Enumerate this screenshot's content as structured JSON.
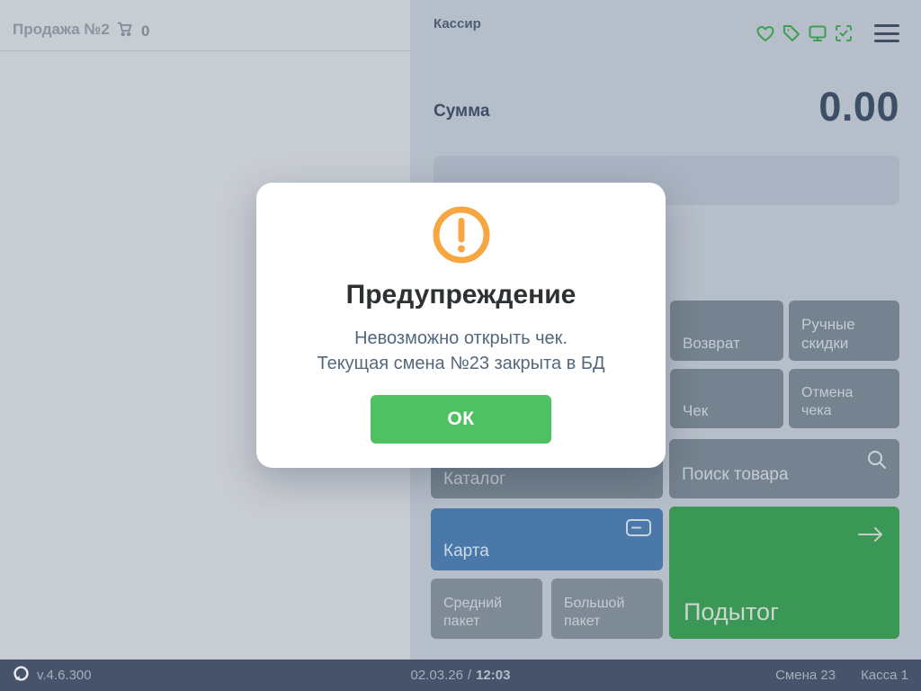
{
  "header": {
    "sale_title": "Продажа №2",
    "cart_count": "0",
    "cashier_label": "Кассир"
  },
  "sum": {
    "label": "Сумма",
    "value": "0.00"
  },
  "actions": {
    "vozvrat": "Возврат",
    "ruchnye_skidki": "Ручные скидки",
    "chek": "Чек",
    "otmena_cheka": "Отмена чека",
    "katalog": "Каталог",
    "poisk_tovara": "Поиск товара",
    "karta": "Карта",
    "sredniy_paket": "Средний пакет",
    "bolshoy_paket": "Большой пакет",
    "podytog": "Подытог"
  },
  "modal": {
    "title": "Предупреждение",
    "message_line1": "Невозможно открыть чек.",
    "message_line2": "Текущая смена №23 закрыта в БД",
    "ok_label": "ОК"
  },
  "status_bar": {
    "version": "v.4.6.300",
    "date": "02.03.26",
    "separator": "/",
    "time": "12:03",
    "shift": "Смена 23",
    "register": "Касса 1"
  },
  "icons": {
    "top": [
      "heart-icon",
      "tag-icon",
      "display-icon",
      "scan-check-icon",
      "menu-icon"
    ],
    "buttons": [
      "catalog-icon",
      "search-icon",
      "card-icon",
      "arrow-right-icon"
    ],
    "other": [
      "cart-icon",
      "warning-icon",
      "app-logo"
    ]
  },
  "colors": {
    "left_bg": "#c8ccd3",
    "right_bg": "#b6bec9",
    "accent_green": "#3f9e53",
    "button_gray": "#75828f",
    "button_blue": "#4a79a9",
    "button_green": "#3a9756",
    "ok_green": "#4fc163",
    "warning_orange": "#f7a742",
    "status_bar": "#46536a"
  }
}
